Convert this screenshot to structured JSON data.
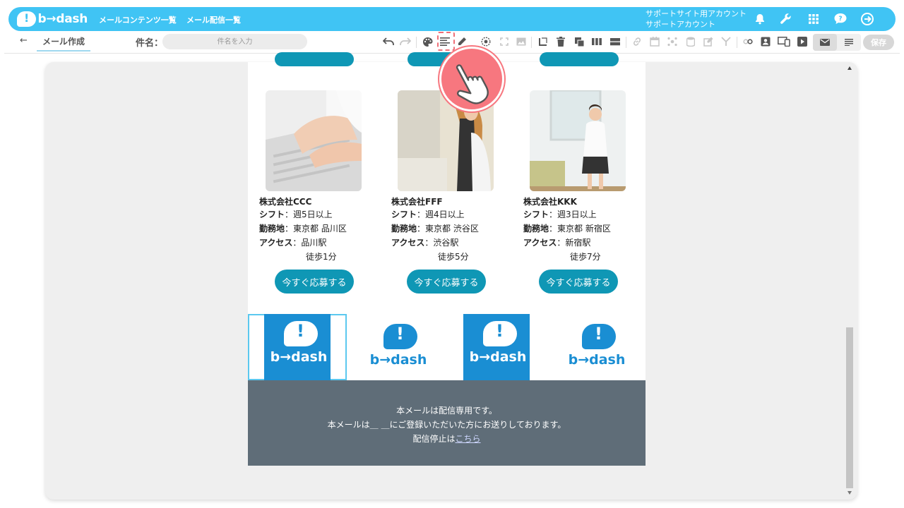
{
  "app": {
    "logo_text": "b→dash",
    "nav": [
      {
        "label": "メールコンテンツ一覧"
      },
      {
        "label": "メール配信一覧"
      }
    ],
    "account_line1": "サポートサイト用アカウント",
    "account_line2": "サポートアカウント",
    "top_icons": [
      "bell-icon",
      "wrench-icon",
      "grid-icon",
      "help-chat-icon",
      "logout-icon"
    ]
  },
  "toolbar": {
    "back_label": "←",
    "tab_label": "メール作成",
    "subject_label": "件名：",
    "subject_placeholder": "件名を入力",
    "save_label": "保存"
  },
  "mail": {
    "jobs": [
      {
        "company": "株式会社CCC",
        "shift_label": "シフト",
        "shift": "：週5日以上",
        "location_label": "勤務地",
        "location": "：東京都 品川区",
        "access_label": "アクセス",
        "access": "：品川駅",
        "walk": "徒歩1分",
        "button": "今すぐ応募する"
      },
      {
        "company": "株式会社FFF",
        "shift_label": "シフト",
        "shift": "：週4日以上",
        "location_label": "勤務地",
        "location": "：東京都 渋谷区",
        "access_label": "アクセス",
        "access": "：渋谷駅",
        "walk": "徒歩5分",
        "button": "今すぐ応募する"
      },
      {
        "company": "株式会社KKK",
        "shift_label": "シフト",
        "shift": "：週3日以上",
        "location_label": "勤務地",
        "location": "：東京都 新宿区",
        "access_label": "アクセス",
        "access": "：新宿駅",
        "walk": "徒歩7分",
        "button": "今すぐ応募する"
      }
    ],
    "logo_text": "b→dash",
    "footer_line1": "本メールは配信専用です。",
    "footer_line2": "本メールは＿ ＿にご登録いただいた方にお送りしております。",
    "footer_line3_prefix": "配信停止は",
    "footer_link": "こちら"
  },
  "colors": {
    "brand": "#40c4f4",
    "button": "#0f97b5",
    "logo_blue": "#1a8ed3",
    "footer_bg": "#5f6d78",
    "pointer": "#f7777f"
  }
}
